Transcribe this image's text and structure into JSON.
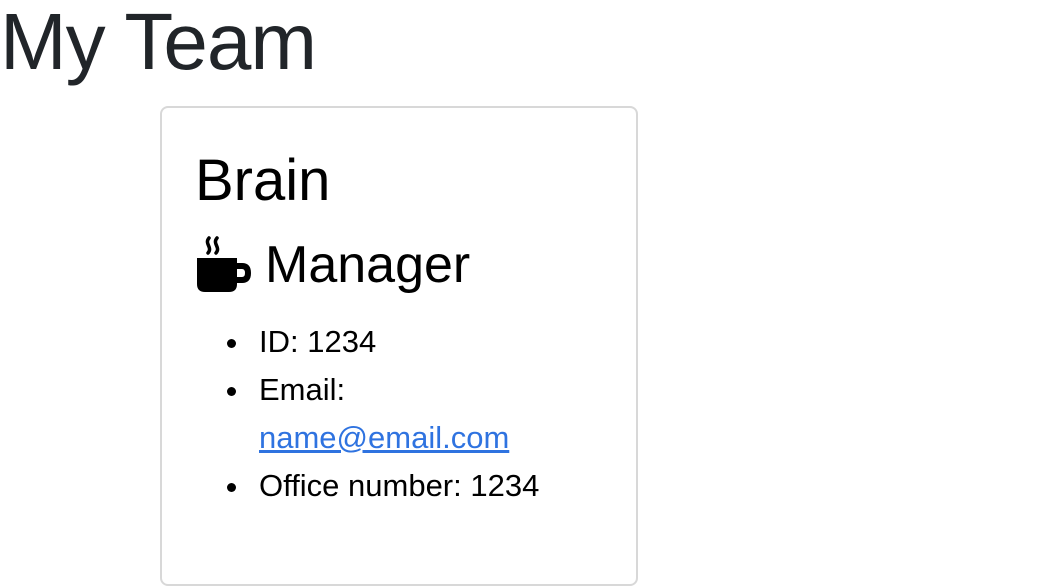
{
  "page": {
    "title": "My Team"
  },
  "card": {
    "name": "Brain",
    "role_icon": "coffee-mug-icon",
    "role": "Manager",
    "id_label": "ID: ",
    "id_value": "1234",
    "email_label": "Email:",
    "email_value": "name@email.com",
    "email_href": "mailto:name@email.com",
    "office_label": "Office number: ",
    "office_value": "1234"
  },
  "colors": {
    "link": "#2f73e0",
    "title": "#212529",
    "card_border": "#d8d8d8"
  }
}
